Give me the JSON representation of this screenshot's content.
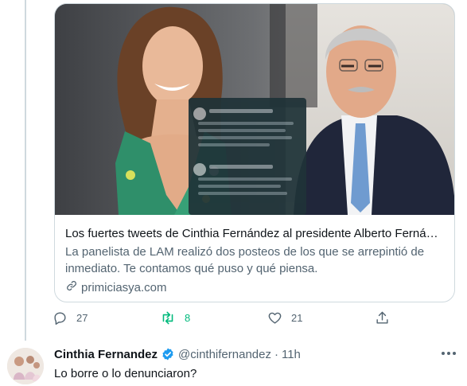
{
  "card": {
    "title": "Los fuertes tweets de Cinthia Fernández al presidente Alberto Fernández ...",
    "description": "La panelista de LAM realizó dos posteos de los que se arrepintió de inmediato. Te contamos qué puso y qué piensa.",
    "domain": "primiciasya.com",
    "image_icon": "link-icon"
  },
  "actions": {
    "reply_count": "27",
    "retweet_count": "8",
    "like_count": "21",
    "icons": [
      "reply-icon",
      "retweet-icon",
      "like-icon",
      "share-icon"
    ],
    "retweet_color": "#00ba7c"
  },
  "reply_tweet": {
    "name": "Cinthia Fernandez",
    "handle": "@cinthifernandez",
    "separator": "·",
    "time": "11h",
    "text": "Lo borre o lo denunciaron?",
    "verified_color": "#1d9bf0"
  }
}
